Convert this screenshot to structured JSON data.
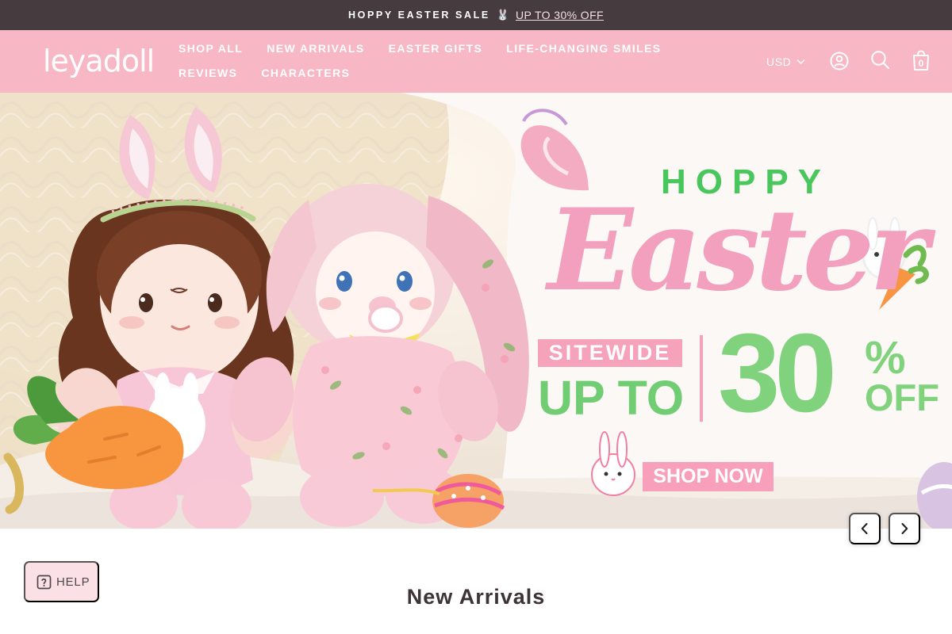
{
  "announcement": {
    "sale_text": "HOPPY EASTER SALE",
    "bunny_icon": "🐰",
    "link_text": "UP TO 30% OFF"
  },
  "header": {
    "logo_text": "leyadoll",
    "nav": {
      "items": [
        {
          "label": "SHOP ALL"
        },
        {
          "label": "NEW ARRIVALS"
        },
        {
          "label": "EASTER GIFTS"
        },
        {
          "label": "LIFE-CHANGING SMILES"
        },
        {
          "label": "REVIEWS"
        },
        {
          "label": "CHARACTERS"
        }
      ]
    },
    "currency": "USD",
    "cart_count": "0",
    "icons": [
      "user-icon",
      "search-icon",
      "shopping-bag-icon",
      "chevron-down-icon"
    ]
  },
  "hero": {
    "headline": "HOPPY",
    "script_title": "Easter",
    "sitewide": "SITEWIDE",
    "up_to": "UP TO",
    "discount_value": "30",
    "percent": "%",
    "off": "OFF",
    "cta": "SHOP NOW"
  },
  "slider": {
    "prev_icon": "chevron-left-icon",
    "next_icon": "chevron-right-icon"
  },
  "help": {
    "label": "HELP",
    "icon": "question-icon"
  },
  "section": {
    "title": "New Arrivals"
  },
  "colors": {
    "announcement_bg": "#463b3e",
    "header_bg": "#f8b7c5",
    "pink": "#f6a2bb",
    "green": "#7fd17d"
  }
}
